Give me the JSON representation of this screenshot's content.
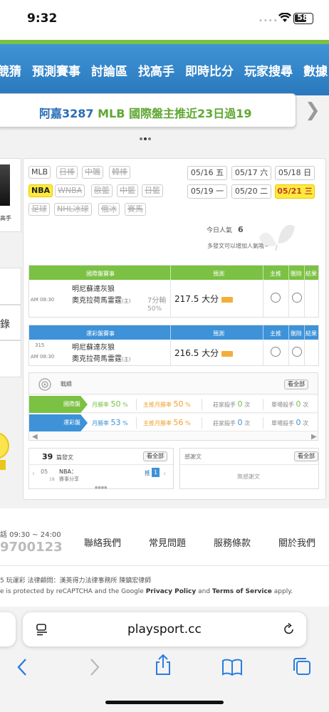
{
  "status": {
    "time": "9:32",
    "battery": "58"
  },
  "nav": {
    "items": [
      "競猜",
      "預測賽事",
      "討論區",
      "找高手",
      "即時比分",
      "玩家搜尋",
      "數據"
    ]
  },
  "marquee": {
    "name": "阿嘉3287",
    "text": "MLB 國際盤主推近23日過19"
  },
  "left_stub": {
    "label1": "高手",
    "label2": "錄"
  },
  "sports": [
    {
      "label": "MLB",
      "state": "normal"
    },
    {
      "label": "日棒",
      "state": "struck"
    },
    {
      "label": "中職",
      "state": "struck"
    },
    {
      "label": "韓棒",
      "state": "struck"
    },
    {
      "label": "NBA",
      "state": "active"
    },
    {
      "label": "WNBA",
      "state": "struck"
    },
    {
      "label": "歐籃",
      "state": "struck"
    },
    {
      "label": "中籃",
      "state": "struck"
    },
    {
      "label": "日籃",
      "state": "struck"
    },
    {
      "label": "足球",
      "state": "struck"
    },
    {
      "label": "NHL冰球",
      "state": "struck"
    },
    {
      "label": "俄冰",
      "state": "struck"
    },
    {
      "label": "賽馬",
      "state": "struck"
    }
  ],
  "dates": [
    {
      "label": "05/16 五",
      "active": false
    },
    {
      "label": "05/17 六",
      "active": false
    },
    {
      "label": "05/18 日",
      "active": false
    },
    {
      "label": "05/19 一",
      "active": false
    },
    {
      "label": "05/20 二",
      "active": false
    },
    {
      "label": "05/21 三",
      "active": true
    }
  ],
  "popularity": {
    "label": "今日人氣",
    "value": "6",
    "tip": "多發文可以增加人氣哦~"
  },
  "intl_table": {
    "header": {
      "title": "國際盤賽事",
      "predict": "預測",
      "main": "主推",
      "delete": "刪除",
      "result": "結果"
    },
    "row": {
      "time": "AM 08:30",
      "team1": "明尼蘇達灰狼",
      "team2": "奧克拉荷馬雷霆",
      "home": "(主)",
      "spread": "7分輸",
      "pct": "50%",
      "pick": "217.5 大分"
    }
  },
  "lottery_table": {
    "header": {
      "title": "運彩盤賽事",
      "predict": "預測",
      "main": "主推",
      "delete": "刪除",
      "result": "結果"
    },
    "row": {
      "num": "315",
      "time": "AM 08:30",
      "team1": "明尼蘇達灰狼",
      "team2": "奧克拉荷馬雷霆",
      "home": "(主)",
      "pick": "216.5 大分"
    }
  },
  "stats": {
    "title": "戰績",
    "view_all": "看全部",
    "rows": [
      {
        "label": "國際盤",
        "month_label": "月勝率",
        "month_val": "50",
        "main_label": "主推月勝率",
        "main_val": "50",
        "banker_label": "莊家殺手",
        "banker_val": "0",
        "single_label": "單場殺手",
        "single_val": "0",
        "pct": "%",
        "unit": "次"
      },
      {
        "label": "運彩盤",
        "month_label": "月勝率",
        "month_val": "53",
        "main_label": "主推月勝率",
        "main_val": "56",
        "banker_label": "莊家殺手",
        "banker_val": "0",
        "single_label": "單場殺手",
        "single_val": "0",
        "pct": "%",
        "unit": "次"
      }
    ]
  },
  "posts": {
    "count": "39",
    "label": "篇發文",
    "view_all": "看全部",
    "date_month": "05",
    "date_day": "18",
    "league": "NBA：",
    "desc": "賽事分享",
    "push_label": "推",
    "push_count": "1"
  },
  "thanks": {
    "title": "感謝文",
    "view_all": "看全部",
    "empty": "無感謝文"
  },
  "footer": {
    "hours": "話 09:30 ~ 24:00",
    "phone": "9700123",
    "links": [
      "聯絡我們",
      "常見問題",
      "服務條款",
      "關於我們"
    ],
    "legal": "5 玩運彩  法律顧問：漢英得力法律事務所 陳鎮宏律師",
    "recaptcha_prefix": "e is protected by reCAPTCHA and the Google ",
    "privacy": "Privacy Policy",
    "and": " and ",
    "terms": "Terms of Service",
    "apply": " apply."
  },
  "browser": {
    "url": "playsport.cc"
  },
  "colors": {
    "green": "#7bc143",
    "blue": "#3d92d8",
    "nav": "#2f80c5",
    "orange": "#f0a030",
    "active_date": "#ffeb3b"
  }
}
